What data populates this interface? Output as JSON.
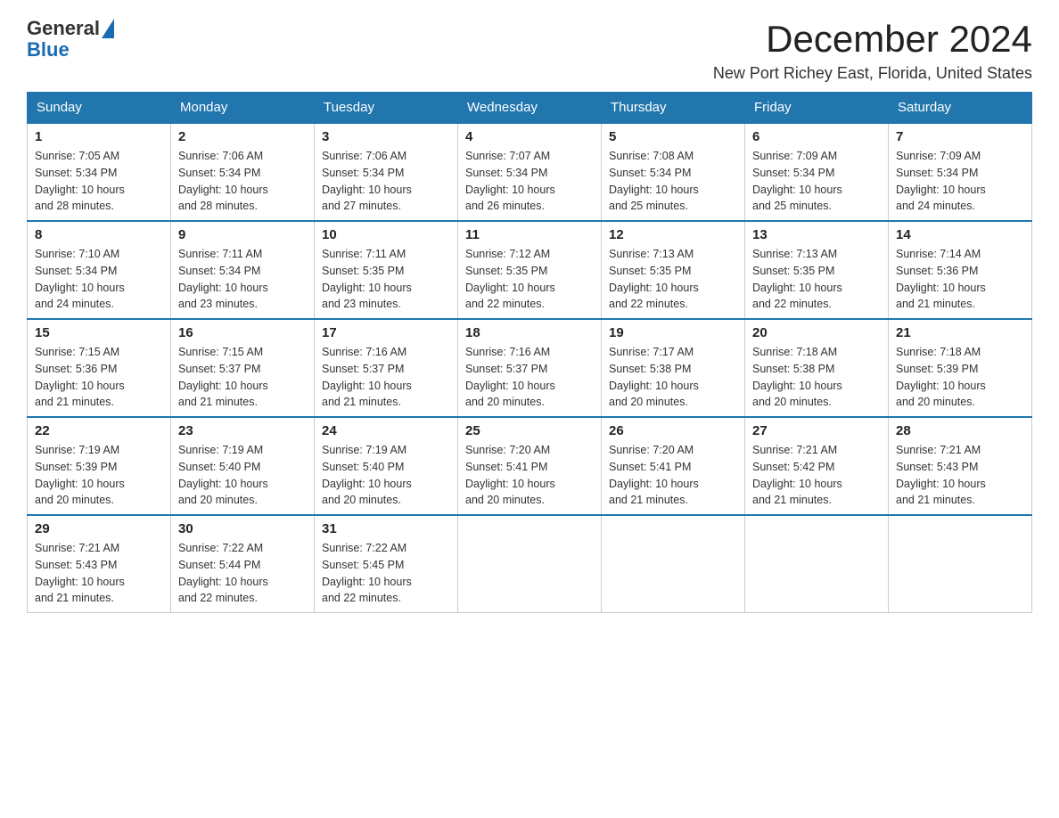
{
  "header": {
    "logo_general": "General",
    "logo_blue": "Blue",
    "month_year": "December 2024",
    "location": "New Port Richey East, Florida, United States"
  },
  "days_of_week": [
    "Sunday",
    "Monday",
    "Tuesday",
    "Wednesday",
    "Thursday",
    "Friday",
    "Saturday"
  ],
  "weeks": [
    [
      {
        "day": "1",
        "sunrise": "7:05 AM",
        "sunset": "5:34 PM",
        "daylight": "10 hours and 28 minutes."
      },
      {
        "day": "2",
        "sunrise": "7:06 AM",
        "sunset": "5:34 PM",
        "daylight": "10 hours and 28 minutes."
      },
      {
        "day": "3",
        "sunrise": "7:06 AM",
        "sunset": "5:34 PM",
        "daylight": "10 hours and 27 minutes."
      },
      {
        "day": "4",
        "sunrise": "7:07 AM",
        "sunset": "5:34 PM",
        "daylight": "10 hours and 26 minutes."
      },
      {
        "day": "5",
        "sunrise": "7:08 AM",
        "sunset": "5:34 PM",
        "daylight": "10 hours and 25 minutes."
      },
      {
        "day": "6",
        "sunrise": "7:09 AM",
        "sunset": "5:34 PM",
        "daylight": "10 hours and 25 minutes."
      },
      {
        "day": "7",
        "sunrise": "7:09 AM",
        "sunset": "5:34 PM",
        "daylight": "10 hours and 24 minutes."
      }
    ],
    [
      {
        "day": "8",
        "sunrise": "7:10 AM",
        "sunset": "5:34 PM",
        "daylight": "10 hours and 24 minutes."
      },
      {
        "day": "9",
        "sunrise": "7:11 AM",
        "sunset": "5:34 PM",
        "daylight": "10 hours and 23 minutes."
      },
      {
        "day": "10",
        "sunrise": "7:11 AM",
        "sunset": "5:35 PM",
        "daylight": "10 hours and 23 minutes."
      },
      {
        "day": "11",
        "sunrise": "7:12 AM",
        "sunset": "5:35 PM",
        "daylight": "10 hours and 22 minutes."
      },
      {
        "day": "12",
        "sunrise": "7:13 AM",
        "sunset": "5:35 PM",
        "daylight": "10 hours and 22 minutes."
      },
      {
        "day": "13",
        "sunrise": "7:13 AM",
        "sunset": "5:35 PM",
        "daylight": "10 hours and 22 minutes."
      },
      {
        "day": "14",
        "sunrise": "7:14 AM",
        "sunset": "5:36 PM",
        "daylight": "10 hours and 21 minutes."
      }
    ],
    [
      {
        "day": "15",
        "sunrise": "7:15 AM",
        "sunset": "5:36 PM",
        "daylight": "10 hours and 21 minutes."
      },
      {
        "day": "16",
        "sunrise": "7:15 AM",
        "sunset": "5:37 PM",
        "daylight": "10 hours and 21 minutes."
      },
      {
        "day": "17",
        "sunrise": "7:16 AM",
        "sunset": "5:37 PM",
        "daylight": "10 hours and 21 minutes."
      },
      {
        "day": "18",
        "sunrise": "7:16 AM",
        "sunset": "5:37 PM",
        "daylight": "10 hours and 20 minutes."
      },
      {
        "day": "19",
        "sunrise": "7:17 AM",
        "sunset": "5:38 PM",
        "daylight": "10 hours and 20 minutes."
      },
      {
        "day": "20",
        "sunrise": "7:18 AM",
        "sunset": "5:38 PM",
        "daylight": "10 hours and 20 minutes."
      },
      {
        "day": "21",
        "sunrise": "7:18 AM",
        "sunset": "5:39 PM",
        "daylight": "10 hours and 20 minutes."
      }
    ],
    [
      {
        "day": "22",
        "sunrise": "7:19 AM",
        "sunset": "5:39 PM",
        "daylight": "10 hours and 20 minutes."
      },
      {
        "day": "23",
        "sunrise": "7:19 AM",
        "sunset": "5:40 PM",
        "daylight": "10 hours and 20 minutes."
      },
      {
        "day": "24",
        "sunrise": "7:19 AM",
        "sunset": "5:40 PM",
        "daylight": "10 hours and 20 minutes."
      },
      {
        "day": "25",
        "sunrise": "7:20 AM",
        "sunset": "5:41 PM",
        "daylight": "10 hours and 20 minutes."
      },
      {
        "day": "26",
        "sunrise": "7:20 AM",
        "sunset": "5:41 PM",
        "daylight": "10 hours and 21 minutes."
      },
      {
        "day": "27",
        "sunrise": "7:21 AM",
        "sunset": "5:42 PM",
        "daylight": "10 hours and 21 minutes."
      },
      {
        "day": "28",
        "sunrise": "7:21 AM",
        "sunset": "5:43 PM",
        "daylight": "10 hours and 21 minutes."
      }
    ],
    [
      {
        "day": "29",
        "sunrise": "7:21 AM",
        "sunset": "5:43 PM",
        "daylight": "10 hours and 21 minutes."
      },
      {
        "day": "30",
        "sunrise": "7:22 AM",
        "sunset": "5:44 PM",
        "daylight": "10 hours and 22 minutes."
      },
      {
        "day": "31",
        "sunrise": "7:22 AM",
        "sunset": "5:45 PM",
        "daylight": "10 hours and 22 minutes."
      },
      null,
      null,
      null,
      null
    ]
  ],
  "labels": {
    "sunrise": "Sunrise:",
    "sunset": "Sunset:",
    "daylight": "Daylight:"
  }
}
